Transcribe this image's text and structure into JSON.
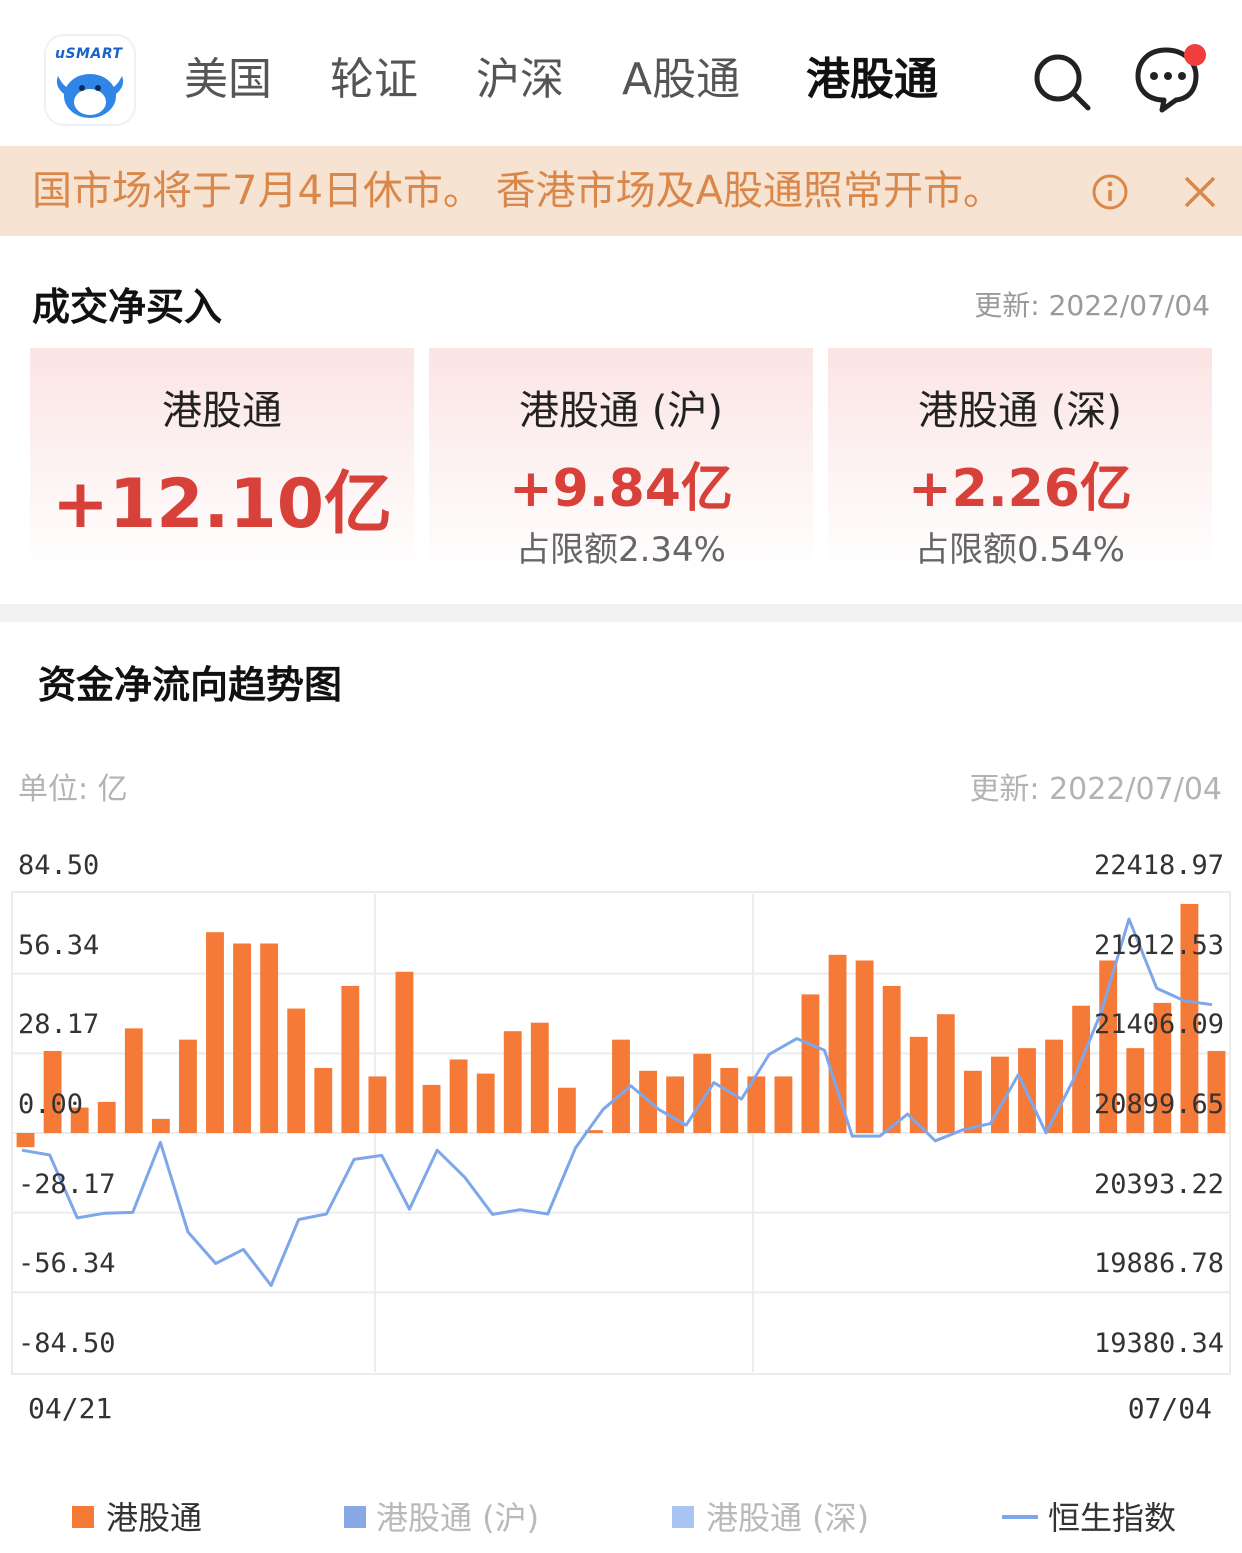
{
  "app": {
    "logo_text": "uSMART"
  },
  "tabs": [
    {
      "label": "美国",
      "active": false
    },
    {
      "label": "轮证",
      "active": false
    },
    {
      "label": "沪深",
      "active": false
    },
    {
      "label": "A股通",
      "active": false
    },
    {
      "label": "港股通",
      "active": true
    }
  ],
  "header_icons": {
    "search": "search-icon",
    "messages": "chat-bubble-icon",
    "notification_dot_color": "#f03e3e"
  },
  "banner": {
    "text": "国市场将于7月4日休市。 香港市场及A股通照常开市。",
    "info_icon": "info-icon",
    "close_icon": "close-icon"
  },
  "net_buy": {
    "title": "成交净买入",
    "update": "更新: 2022/07/04",
    "cards": [
      {
        "title": "港股通",
        "value": "+12.10亿",
        "sub": ""
      },
      {
        "title": "港股通 (沪)",
        "value": "+9.84亿",
        "sub": "占限额2.34%"
      },
      {
        "title": "港股通 (深)",
        "value": "+2.26亿",
        "sub": "占限额0.54%"
      }
    ]
  },
  "trend": {
    "title": "资金净流向趋势图",
    "unit": "单位: 亿",
    "update": "更新: 2022/07/04"
  },
  "colors": {
    "bar": "#f57a38",
    "line": "#7ea6ea",
    "value_red": "#d8413a",
    "legend_sh": "#8aa7e8",
    "legend_sz": "#a9c4f3"
  },
  "chart_data": {
    "type": "bar+line",
    "x_start_label": "04/21",
    "x_end_label": "07/04",
    "left_axis": {
      "ticks": [
        "84.50",
        "56.34",
        "28.17",
        "0.00",
        "-28.17",
        "-56.34",
        "-84.50"
      ],
      "ylim": [
        -84.5,
        84.5
      ]
    },
    "right_axis": {
      "ticks": [
        "22418.97",
        "21912.53",
        "21406.09",
        "20899.65",
        "20393.22",
        "19886.78",
        "19380.34"
      ],
      "ylim": [
        19380.34,
        22418.97
      ]
    },
    "series": [
      {
        "name": "港股通",
        "type": "bar",
        "values": [
          -5,
          29,
          9,
          11,
          37,
          5,
          33,
          71,
          67,
          67,
          44,
          23,
          52,
          20,
          57,
          17,
          26,
          21,
          36,
          39,
          16,
          1,
          33,
          22,
          20,
          28,
          23,
          20,
          20,
          49,
          63,
          61,
          52,
          34,
          42,
          22,
          27,
          30,
          33,
          45,
          61,
          30,
          46,
          81,
          29
        ]
      },
      {
        "name": "港股通 (沪)",
        "type": "bar",
        "values": []
      },
      {
        "name": "港股通 (深)",
        "type": "bar",
        "values": []
      },
      {
        "name": "恒生指数",
        "type": "line",
        "values": [
          20790,
          20760,
          20360,
          20390,
          20395,
          20840,
          20270,
          20070,
          20160,
          19930,
          20350,
          20385,
          20732,
          20757,
          20415,
          20790,
          20618,
          20382,
          20412,
          20385,
          20805,
          21050,
          21200,
          21050,
          20950,
          21220,
          21115,
          21400,
          21500,
          21425,
          20880,
          20880,
          21020,
          20850,
          20920,
          20960,
          21270,
          20900,
          21240,
          21670,
          22260,
          21820,
          21740,
          21715
        ]
      }
    ]
  },
  "legend": [
    {
      "label": "港股通",
      "kind": "swatch",
      "color": "#f57a38"
    },
    {
      "label": "港股通 (沪)",
      "kind": "swatch",
      "color": "#8aa7e8"
    },
    {
      "label": "港股通 (深)",
      "kind": "swatch",
      "color": "#a9c4f3"
    },
    {
      "label": "恒生指数",
      "kind": "line",
      "color": "#7ea6ea"
    }
  ]
}
